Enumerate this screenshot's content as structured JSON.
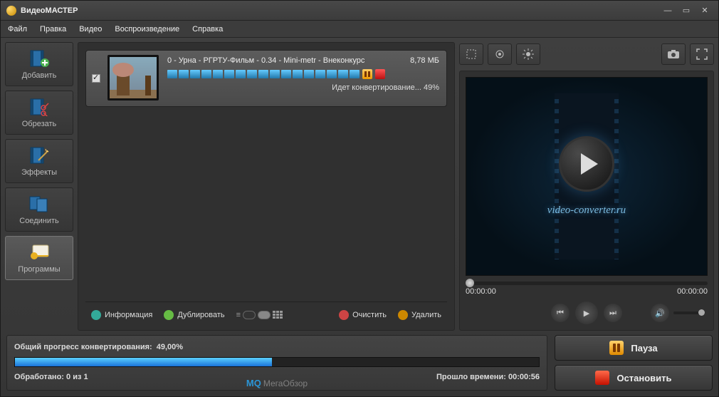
{
  "app": {
    "title": "ВидеоМАСТЕР"
  },
  "menu": {
    "file": "Файл",
    "edit": "Правка",
    "video": "Видео",
    "playback": "Воспроизведение",
    "help": "Справка"
  },
  "sidebar": {
    "add": "Добавить",
    "trim": "Обрезать",
    "effects": "Эффекты",
    "join": "Соединить",
    "programs": "Программы"
  },
  "file": {
    "name": "0 - Урна - РГРТУ-Фильм - 0.34 - Mini-metr - Внеконкурс",
    "size": "8,78 МБ",
    "status": "Идет конвертирование... 49%"
  },
  "listtb": {
    "info": "Информация",
    "dup": "Дублировать",
    "clear": "Очистить",
    "del": "Удалить"
  },
  "preview": {
    "url": "video-converter.ru",
    "t0": "00:00:00",
    "t1": "00:00:00"
  },
  "progress": {
    "label_prefix": "Общий прогресс конвертирования:",
    "percent": "49,00%",
    "processed_label": "Обработано:",
    "processed_value": "0 из 1",
    "elapsed_label": "Прошло времени:",
    "elapsed_value": "00:00:56"
  },
  "actions": {
    "pause": "Пауза",
    "stop": "Остановить"
  },
  "watermark": {
    "a": "MQ",
    "b": "МегаОбзор"
  }
}
